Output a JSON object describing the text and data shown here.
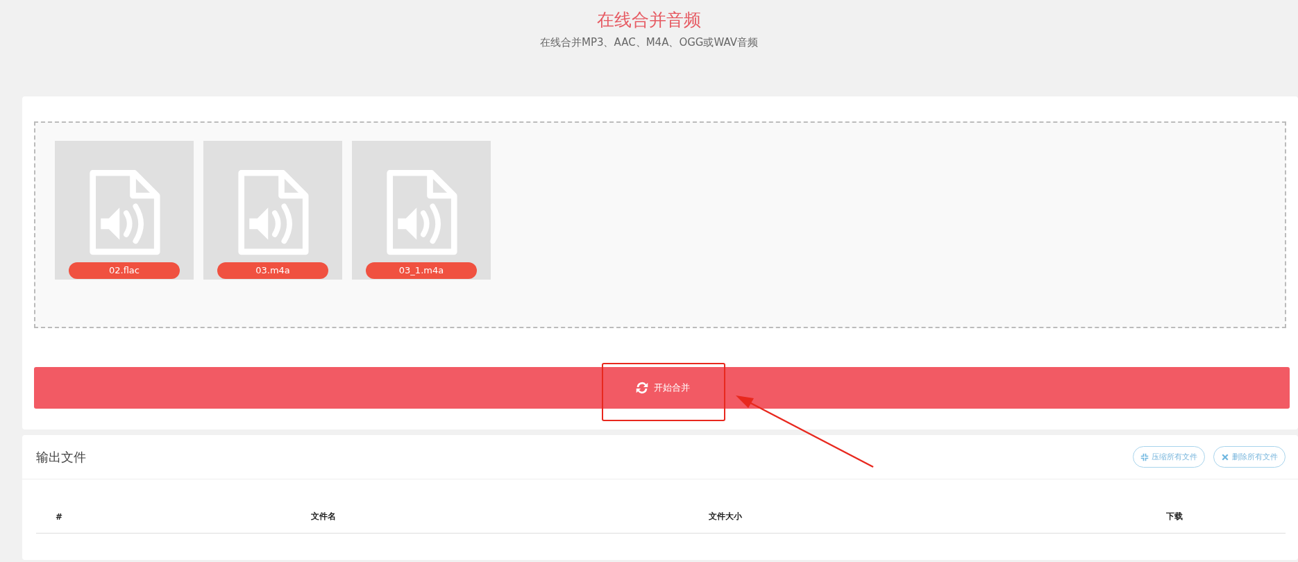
{
  "header": {
    "title": "在线合并音频",
    "subtitle": "在线合并MP3、AAC、M4A、OGG或WAV音频"
  },
  "files": [
    {
      "name": "02.flac"
    },
    {
      "name": "03.m4a"
    },
    {
      "name": "03_1.m4a"
    }
  ],
  "merge_button": {
    "label": "开始合并"
  },
  "output": {
    "title": "输出文件",
    "actions": [
      {
        "label": "压缩所有文件",
        "kind": "compress"
      },
      {
        "label": "删除所有文件",
        "kind": "delete"
      }
    ],
    "table": {
      "columns": [
        "#",
        "文件名",
        "文件大小",
        "下载"
      ]
    }
  }
}
